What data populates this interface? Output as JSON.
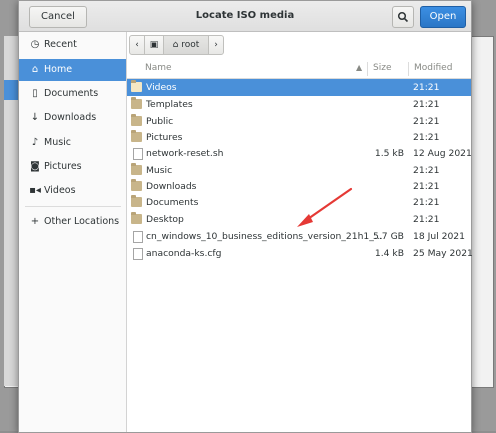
{
  "dialog": {
    "title": "Locate ISO media",
    "cancel_label": "Cancel",
    "open_label": "Open",
    "search_icon": "search-icon"
  },
  "sidebar": {
    "items": [
      {
        "label": "Recent",
        "icon": "clock-icon"
      },
      {
        "label": "Home",
        "icon": "home-icon",
        "active": true
      },
      {
        "label": "Documents",
        "icon": "document-icon"
      },
      {
        "label": "Downloads",
        "icon": "download-icon"
      },
      {
        "label": "Music",
        "icon": "music-icon"
      },
      {
        "label": "Pictures",
        "icon": "camera-icon"
      },
      {
        "label": "Videos",
        "icon": "video-icon"
      },
      {
        "label": "Other Locations",
        "icon": "plus-icon"
      }
    ]
  },
  "pathbar": {
    "current": "root"
  },
  "columns": {
    "name": "Name",
    "size": "Size",
    "modified": "Modified"
  },
  "files": [
    {
      "name": "Videos",
      "size": "",
      "modified": "21:21",
      "type": "folder",
      "selected": true
    },
    {
      "name": "Templates",
      "size": "",
      "modified": "21:21",
      "type": "folder"
    },
    {
      "name": "Public",
      "size": "",
      "modified": "21:21",
      "type": "folder"
    },
    {
      "name": "Pictures",
      "size": "",
      "modified": "21:21",
      "type": "folder"
    },
    {
      "name": "network-reset.sh",
      "size": "1.5 kB",
      "modified": "12 Aug 2021",
      "type": "script"
    },
    {
      "name": "Music",
      "size": "",
      "modified": "21:21",
      "type": "folder"
    },
    {
      "name": "Downloads",
      "size": "",
      "modified": "21:21",
      "type": "folder"
    },
    {
      "name": "Documents",
      "size": "",
      "modified": "21:21",
      "type": "folder"
    },
    {
      "name": "Desktop",
      "size": "",
      "modified": "21:21",
      "type": "folder"
    },
    {
      "name": "cn_windows_10_business_editions_version_21h1_...",
      "size": "5.7 GB",
      "modified": "18 Jul 2021",
      "type": "file"
    },
    {
      "name": "anaconda-ks.cfg",
      "size": "1.4 kB",
      "modified": "25 May 2021",
      "type": "file"
    }
  ],
  "colors": {
    "accent": "#4a90d9",
    "annotation_arrow": "#e53935"
  }
}
